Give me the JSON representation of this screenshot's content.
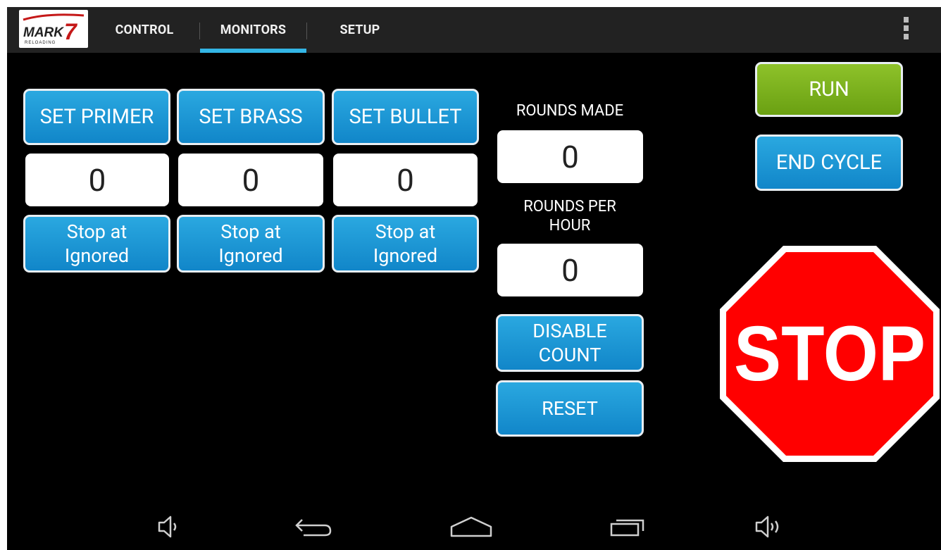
{
  "logo": {
    "main": "MARK",
    "number": "7",
    "sub": "RELOADING"
  },
  "tabs": [
    {
      "label": "CONTROL",
      "selected": false
    },
    {
      "label": "MONITORS",
      "selected": true
    },
    {
      "label": "SETUP",
      "selected": false
    }
  ],
  "monitors": [
    {
      "set_label": "SET PRIMER",
      "count": "0",
      "stop_label": "Stop at\nIgnored"
    },
    {
      "set_label": "SET BRASS",
      "count": "0",
      "stop_label": "Stop at\nIgnored"
    },
    {
      "set_label": "SET BULLET",
      "count": "0",
      "stop_label": "Stop at\nIgnored"
    }
  ],
  "stats": {
    "rounds_made_label": "ROUNDS MADE",
    "rounds_made_value": "0",
    "rounds_per_hour_label": "ROUNDS PER\nHOUR",
    "rounds_per_hour_value": "0"
  },
  "buttons": {
    "disable_count": "DISABLE\nCOUNT",
    "reset": "RESET",
    "run": "RUN",
    "end_cycle": "END CYCLE",
    "stop": "STOP"
  },
  "nav_icons": [
    "volume-down-icon",
    "back-icon",
    "home-icon",
    "recent-apps-icon",
    "volume-up-icon"
  ],
  "colors": {
    "accent_blue": "#1a98d8",
    "run_green": "#7ab51d",
    "stop_red": "#ff0000",
    "tab_indicator": "#33b5e5"
  }
}
